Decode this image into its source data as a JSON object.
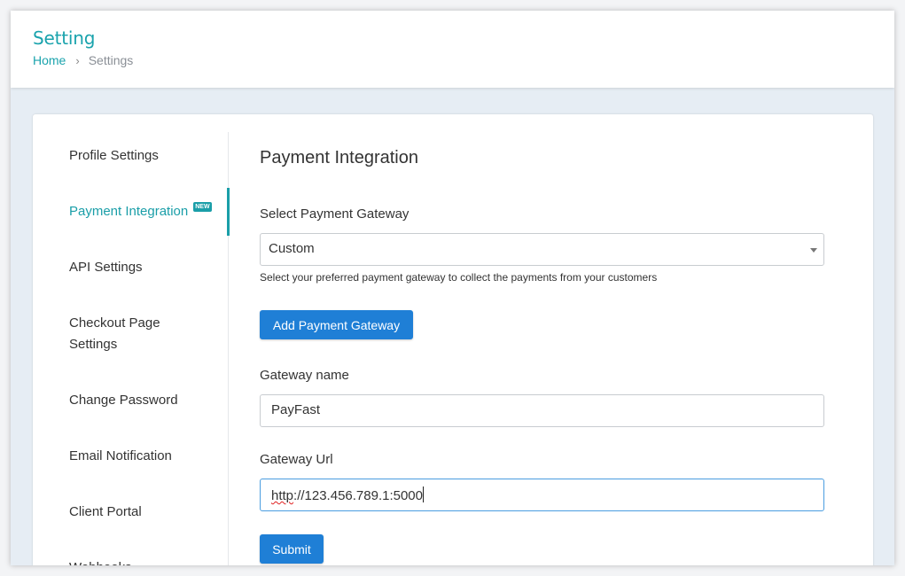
{
  "header": {
    "title": "Setting",
    "breadcrumb": {
      "home": "Home",
      "separator": "›",
      "current": "Settings"
    }
  },
  "sidebar": {
    "items": [
      {
        "label": "Profile Settings",
        "active": false
      },
      {
        "label": "Payment Integration",
        "active": true,
        "badge": "NEW"
      },
      {
        "label": "API Settings",
        "active": false
      },
      {
        "label": "Checkout Page Settings",
        "line1": "Checkout Page",
        "line2": "Settings",
        "active": false
      },
      {
        "label": "Change Password",
        "active": false
      },
      {
        "label": "Email Notification",
        "active": false
      },
      {
        "label": "Client Portal",
        "active": false
      },
      {
        "label": "Webhooks",
        "active": false
      }
    ]
  },
  "main": {
    "section_title": "Payment Integration",
    "gateway_select": {
      "label": "Select Payment Gateway",
      "value": "Custom",
      "help": "Select your preferred payment gateway to collect the payments from your customers"
    },
    "add_gateway_button": "Add Payment Gateway",
    "gateway_name": {
      "label": "Gateway name",
      "value": "PayFast"
    },
    "gateway_url": {
      "label": "Gateway Url",
      "value_prefix": "http",
      "value_rest": "://123.456.789.1:5000"
    },
    "submit_button": "Submit"
  },
  "colors": {
    "accent": "#1aa3ad",
    "primary_button": "#1f7fd6",
    "focus_border": "#4a9de0"
  }
}
